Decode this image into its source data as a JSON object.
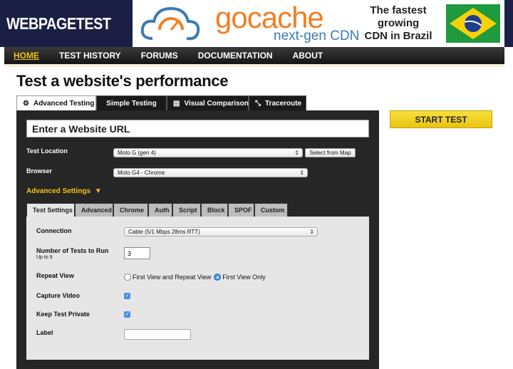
{
  "header": {
    "logo_text": "WEBPAGETEST",
    "ad": {
      "brand": "gocache",
      "subtitle": "next-gen CDN",
      "tagline_1": "The fastest",
      "tagline_2": "growing",
      "tagline_3": "CDN in Brazil"
    }
  },
  "nav": {
    "items": [
      "HOME",
      "TEST HISTORY",
      "FORUMS",
      "DOCUMENTATION",
      "ABOUT"
    ],
    "active": "HOME"
  },
  "page": {
    "title": "Test a website's performance",
    "start_button": "START TEST"
  },
  "tabs": [
    {
      "label": "Advanced Testing",
      "icon": "gear-icon",
      "active": true
    },
    {
      "label": "Simple Testing",
      "icon": "",
      "active": false
    },
    {
      "label": "Visual Comparison",
      "icon": "document-icon",
      "active": false
    },
    {
      "label": "Traceroute",
      "icon": "route-icon",
      "active": false
    }
  ],
  "form": {
    "url_placeholder": "Enter a Website URL",
    "test_location_label": "Test Location",
    "test_location_value": "Moto G (gen 4)",
    "select_from_map": "Select from Map",
    "browser_label": "Browser",
    "browser_value": "Moto G4 - Chrome",
    "advanced_settings": "Advanced Settings",
    "advanced_arrow": "▼"
  },
  "subtabs": [
    "Test Settings",
    "Advanced",
    "Chrome",
    "Auth",
    "Script",
    "Block",
    "SPOF",
    "Custom"
  ],
  "test_settings": {
    "connection_label": "Connection",
    "connection_value": "Cable (5/1 Mbps 28ms RTT)",
    "num_tests_label": "Number of Tests to Run",
    "num_tests_sub": "Up to 9",
    "num_tests_value": "3",
    "repeat_view_label": "Repeat View",
    "repeat_opt_1": "First View and Repeat View",
    "repeat_opt_2": "First View Only",
    "repeat_selected": "First View Only",
    "capture_video_label": "Capture Video",
    "capture_video_checked": true,
    "keep_private_label": "Keep Test Private",
    "keep_private_checked": true,
    "label_label": "Label",
    "label_value": ""
  },
  "colors": {
    "header_bg": "#1b1f45",
    "accent_yellow": "#f0c419",
    "panel_bg": "#262626",
    "brand_orange": "#f07f24"
  }
}
